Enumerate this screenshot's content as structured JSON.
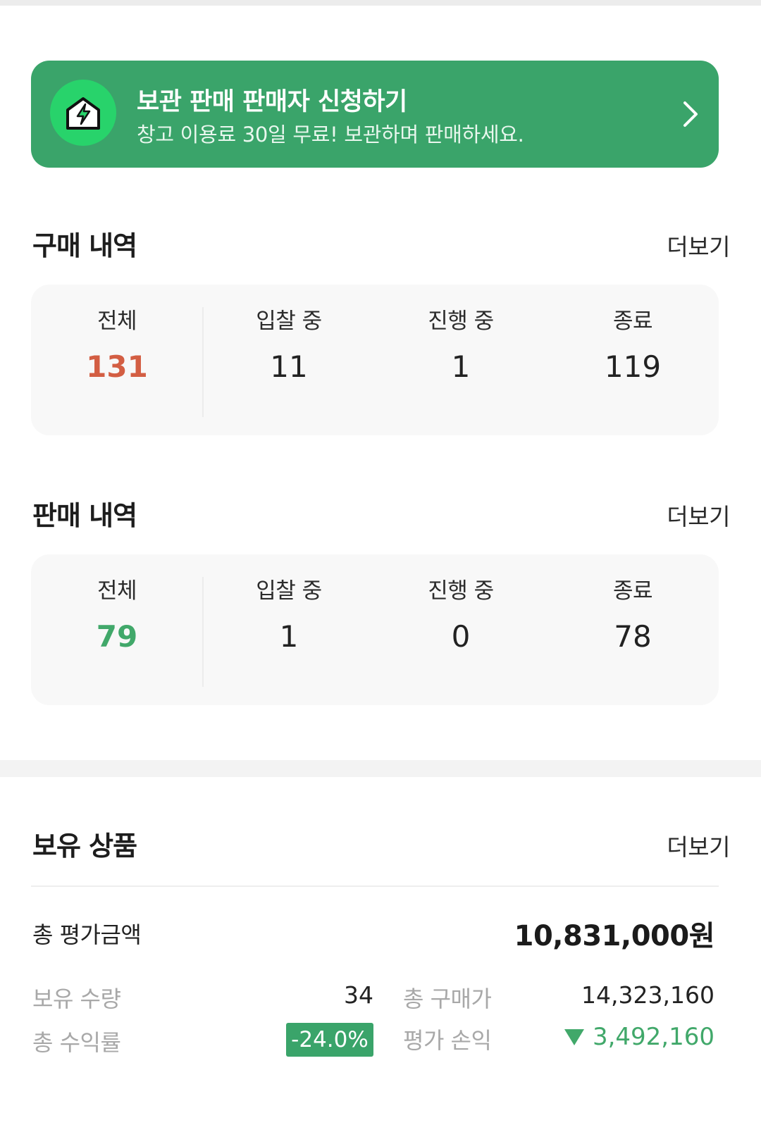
{
  "banner": {
    "title": "보관 판매 판매자 신청하기",
    "subtitle": "창고 이용료 30일 무료! 보관하며 판매하세요.",
    "icon": "warehouse-lightning-icon",
    "accent": "#3aa46a"
  },
  "purchase": {
    "title": "구매 내역",
    "more": "더보기",
    "stats": [
      {
        "label": "전체",
        "value": "131"
      },
      {
        "label": "입찰 중",
        "value": "11"
      },
      {
        "label": "진행 중",
        "value": "1"
      },
      {
        "label": "종료",
        "value": "119"
      }
    ],
    "highlight_color": "#d35e43"
  },
  "sales": {
    "title": "판매 내역",
    "more": "더보기",
    "stats": [
      {
        "label": "전체",
        "value": "79"
      },
      {
        "label": "입찰 중",
        "value": "1"
      },
      {
        "label": "진행 중",
        "value": "0"
      },
      {
        "label": "종료",
        "value": "78"
      }
    ],
    "highlight_color": "#41a86a"
  },
  "holdings": {
    "title": "보유 상품",
    "more": "더보기",
    "total_label": "총 평가금액",
    "total_value": "10,831,000원",
    "quantity_label": "보유 수량",
    "quantity_value": "34",
    "purchase_total_label": "총 구매가",
    "purchase_total_value": "14,323,160",
    "return_label": "총 수익률",
    "return_value": "-24.0%",
    "pl_label": "평가 손익",
    "pl_value": "3,492,160",
    "pl_icon": "triangle-down-icon"
  }
}
